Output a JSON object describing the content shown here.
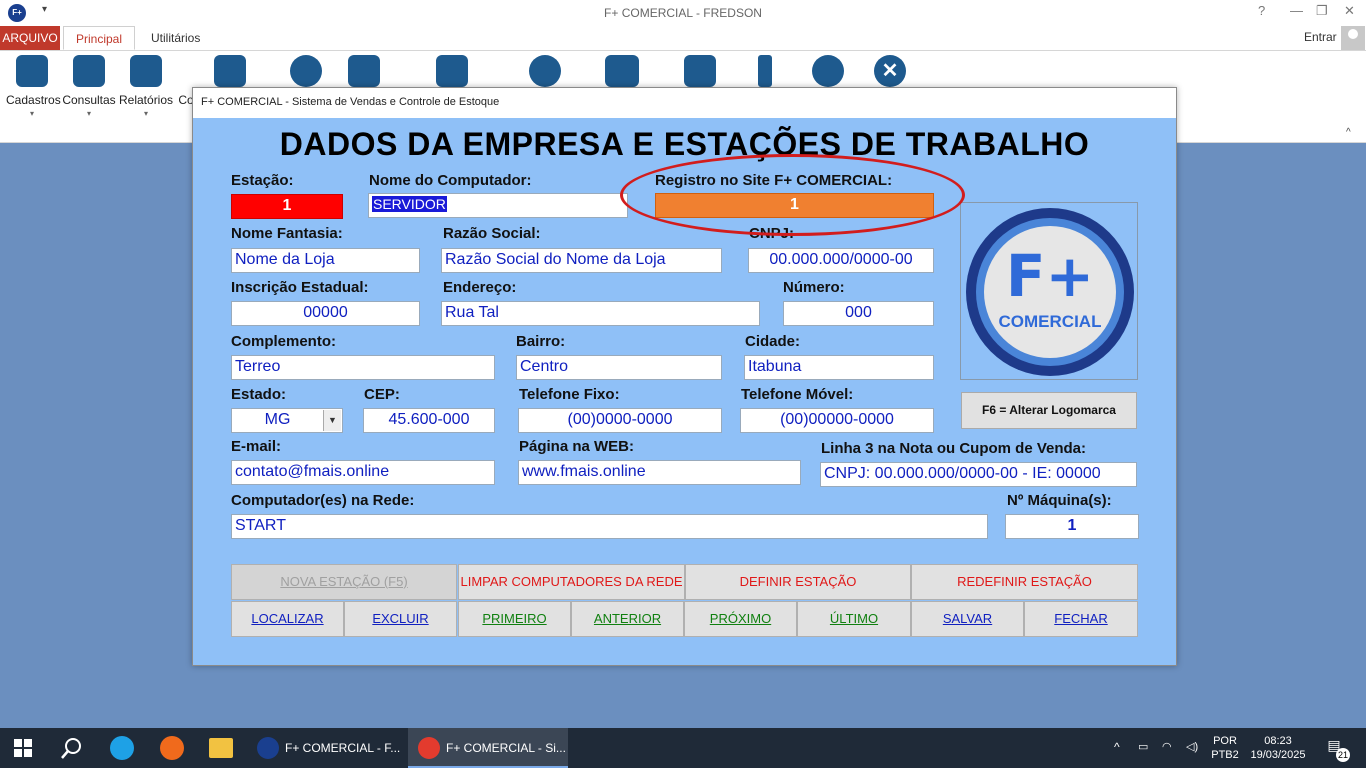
{
  "window": {
    "title": "F+ COMERCIAL - FREDSON",
    "help": "?",
    "minimize": "—",
    "restore": "❐",
    "close": "✕"
  },
  "ribbon_tabs": {
    "file": "ARQUIVO",
    "tabs": [
      "Principal",
      "Utilitários"
    ],
    "enter": "Entrar"
  },
  "ribbon": {
    "items": [
      {
        "label": "Cadastros",
        "icon": "document-add-icon"
      },
      {
        "label": "Consultas",
        "icon": "document-search-icon"
      },
      {
        "label": "Relatórios",
        "icon": "report-icon"
      },
      {
        "label": "Co",
        "icon": ""
      }
    ],
    "more_icons": [
      "monitor-search-icon",
      "gift-icon",
      "calculator-icon",
      "tools-icon",
      "user-icon",
      "chart-monitor-icon",
      "cash-register-icon",
      "info-icon",
      "user-lock-icon",
      "close-circle-icon"
    ]
  },
  "dialog": {
    "title": "F+ COMERCIAL - Sistema de Vendas e Controle de Estoque",
    "heading": "DADOS DA EMPRESA E ESTAÇÕES DE TRABALHO",
    "labels": {
      "estacao": "Estação:",
      "nome_computador": "Nome do Computador:",
      "registro": "Registro no Site F+ COMERCIAL:",
      "nome_fantasia": "Nome Fantasia:",
      "razao_social": "Razão Social:",
      "cnpj": "CNPJ:",
      "inscricao": "Inscrição Estadual:",
      "endereco": "Endereço:",
      "numero": "Número:",
      "complemento": "Complemento:",
      "bairro": "Bairro:",
      "cidade": "Cidade:",
      "estado": "Estado:",
      "cep": "CEP:",
      "telefone_fixo": "Telefone Fixo:",
      "telefone_movel": "Telefone Móvel:",
      "email": "E-mail:",
      "pagina_web": "Página na WEB:",
      "linha3": "Linha 3 na Nota ou Cupom de Venda:",
      "computadores_rede": "Computador(es) na Rede:",
      "num_maquinas": "Nº Máquina(s):"
    },
    "values": {
      "estacao": "1",
      "nome_computador": "SERVIDOR",
      "registro": "1",
      "nome_fantasia": "Nome da Loja",
      "razao_social": "Razão Social do Nome da Loja",
      "cnpj": "00.000.000/0000-00",
      "inscricao": "00000",
      "endereco": "Rua Tal",
      "numero": "000",
      "complemento": "Terreo",
      "bairro": "Centro",
      "cidade": "Itabuna",
      "estado": "MG",
      "cep": "45.600-000",
      "telefone_fixo": "(00)0000-0000",
      "telefone_movel": "(00)00000-0000",
      "email": "contato@fmais.online",
      "pagina_web": "www.fmais.online",
      "linha3": "CNPJ: 00.000.000/0000-00 - IE: 00000",
      "computadores_rede": "START",
      "num_maquinas": "1"
    },
    "logo": {
      "big": "F+",
      "small": "COMERCIAL"
    },
    "logo_button": "F6 = Alterar Logomarca",
    "buttons_row1": [
      "NOVA ESTAÇÃO (F5)",
      "LIMPAR COMPUTADORES DA REDE",
      "DEFINIR ESTAÇÃO",
      "REDEFINIR ESTAÇÃO"
    ],
    "buttons_row2": [
      "LOCALIZAR",
      "EXCLUIR",
      "PRIMEIRO",
      "ANTERIOR",
      "PRÓXIMO",
      "ÚLTIMO",
      "SALVAR",
      "FECHAR"
    ]
  },
  "taskbar": {
    "apps": [
      "F+ COMERCIAL - F...",
      "F+ COMERCIAL - Si..."
    ],
    "lang_top": "POR",
    "lang_bottom": "PTB2",
    "time": "08:23",
    "date": "19/03/2025",
    "notifications": "21"
  },
  "colors": {
    "dialog_bg": "#8fc0f7",
    "accent_red": "#c0392b",
    "field_text": "#1020c0",
    "estacao_bg": "#ff0000",
    "registro_bg": "#f08030"
  }
}
